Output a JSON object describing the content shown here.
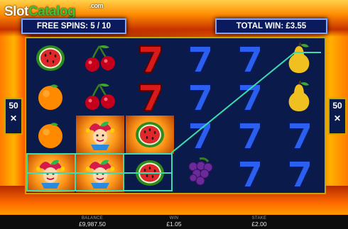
{
  "logo": {
    "part1": "Slot",
    "part2": "Catalog",
    "suffix": ".com"
  },
  "hud": {
    "free_spins": "FREE SPINS: 5 / 10",
    "total_win": "TOTAL WIN: £3.55"
  },
  "side_tags": {
    "left": "50\n✕",
    "right": "50\n✕",
    "left_num": "50",
    "left_x": "✕",
    "right_num": "50",
    "right_x": "✕"
  },
  "reels": [
    [
      "watermelon",
      "orange",
      "orange",
      "jester"
    ],
    [
      "cherry",
      "cherry",
      "jester",
      "jester"
    ],
    [
      "seven-red",
      "seven-red",
      "watermelon",
      "watermelon"
    ],
    [
      "seven-blue",
      "seven-blue",
      "seven-blue",
      "grapes"
    ],
    [
      "seven-blue",
      "seven-blue",
      "seven-blue",
      "seven-blue"
    ],
    [
      "pear",
      "pear",
      "seven-blue",
      "seven-blue"
    ]
  ],
  "colors": {
    "payline": "#3ddcb0",
    "frame": "#c8a400",
    "hud_bg": "#0a1a5c"
  },
  "bottom": {
    "balance_label": "BALANCE",
    "balance_value": "£9,987.50",
    "win_label": "WIN",
    "win_value": "£1.05",
    "stake_label": "STAKE",
    "stake_value": "£2.00"
  }
}
